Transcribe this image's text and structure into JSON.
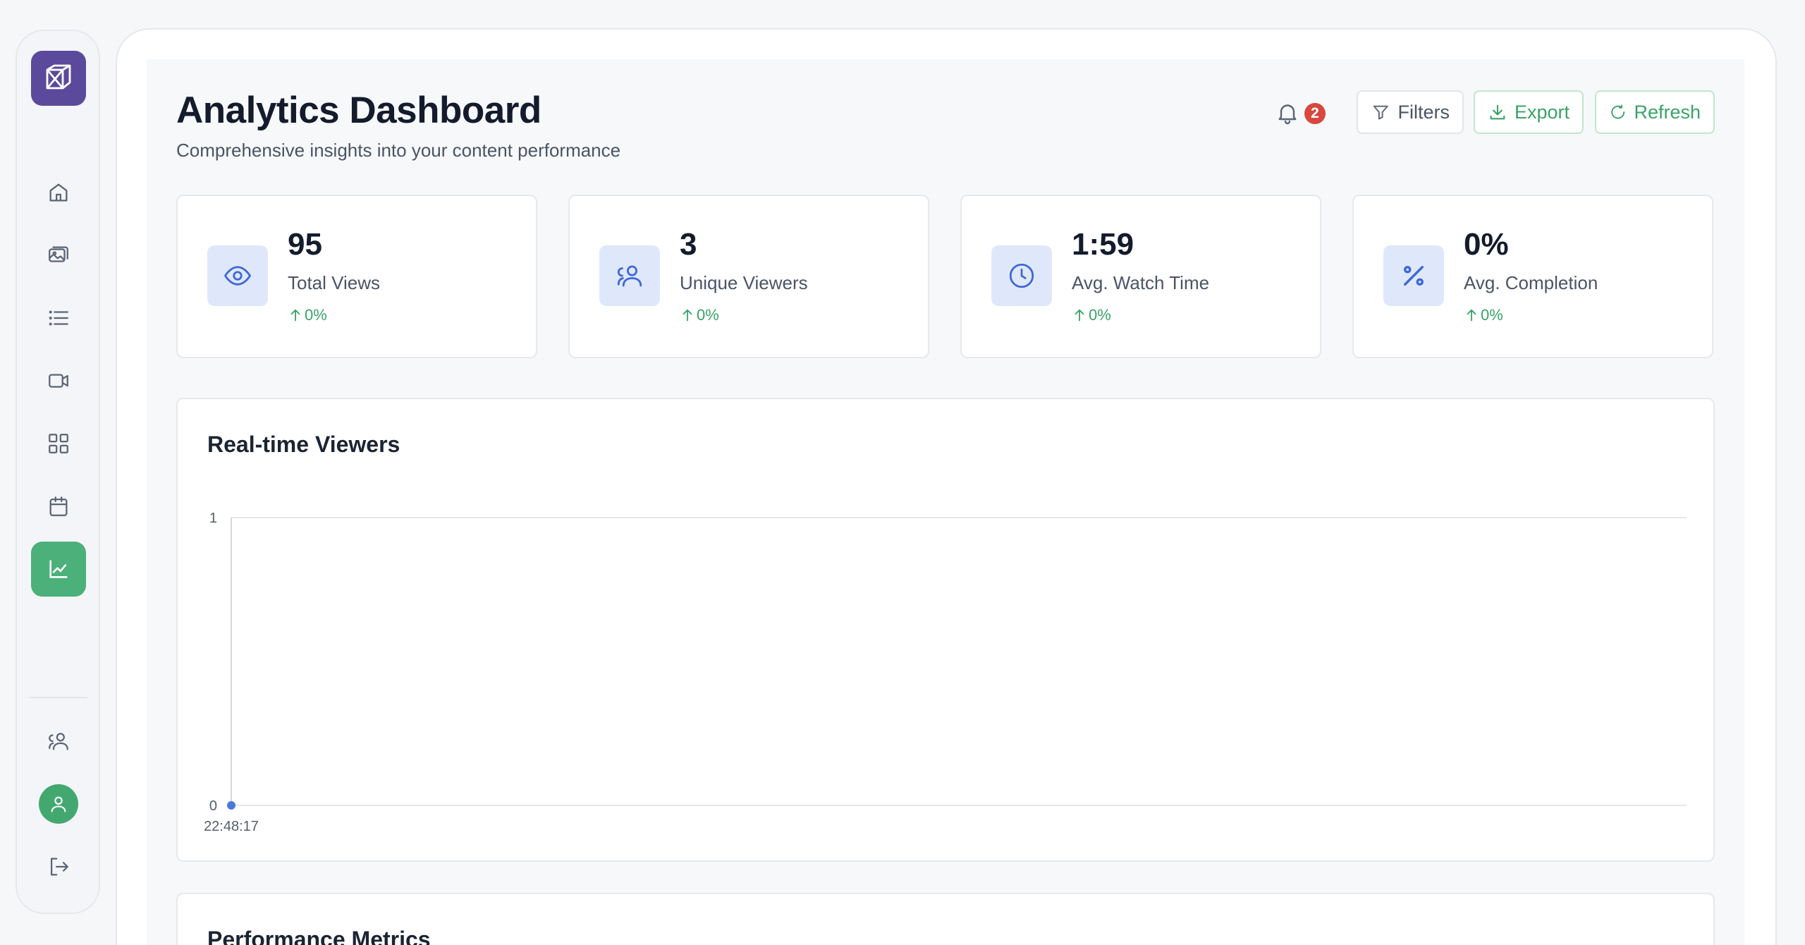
{
  "header": {
    "title": "Analytics Dashboard",
    "subtitle": "Comprehensive insights into your content performance",
    "notification_count": "2",
    "filters_label": "Filters",
    "export_label": "Export",
    "refresh_label": "Refresh"
  },
  "stats": [
    {
      "value": "95",
      "label": "Total Views",
      "change": "0%",
      "icon": "eye-icon"
    },
    {
      "value": "3",
      "label": "Unique Viewers",
      "change": "0%",
      "icon": "users-icon"
    },
    {
      "value": "1:59",
      "label": "Avg. Watch Time",
      "change": "0%",
      "icon": "clock-icon"
    },
    {
      "value": "0%",
      "label": "Avg. Completion",
      "change": "0%",
      "icon": "percent-icon"
    }
  ],
  "realtime": {
    "title": "Real-time Viewers"
  },
  "performance": {
    "title": "Performance Metrics"
  },
  "colors": {
    "accent_green": "#4bb07a",
    "brand_purple": "#5b4a9b",
    "badge_red": "#d8473d",
    "icon_blue": "#3f68d6",
    "point_blue": "#4a78e0"
  },
  "chart_data": {
    "type": "line",
    "title": "Real-time Viewers",
    "x": [
      "22:48:17"
    ],
    "series": [
      {
        "values": [
          0
        ]
      }
    ],
    "ylim": [
      0,
      1
    ],
    "yticks": [
      "1",
      "0"
    ],
    "grid": true
  }
}
